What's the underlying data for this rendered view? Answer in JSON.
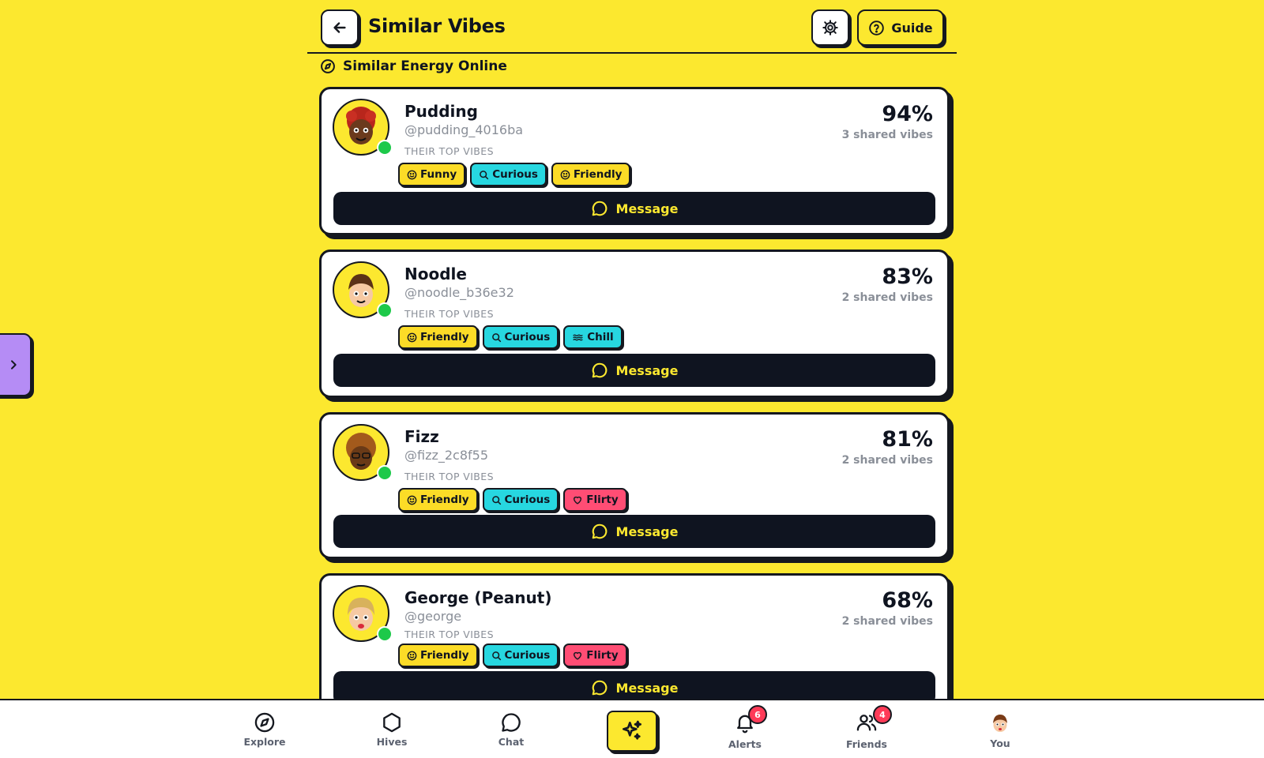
{
  "header": {
    "title": "Similar Vibes",
    "guide_label": "Guide"
  },
  "subheading": "Similar Energy Online",
  "labels": {
    "top_vibes": "THEIR TOP VIBES",
    "message": "Message"
  },
  "colors": {
    "background": "#fce82f",
    "funny_chip": "#fcdc27",
    "curious_chip": "#27d7e0",
    "flirty_chip": "#ff4d74",
    "online": "#1dc94a",
    "side_tab": "#b58cf5"
  },
  "people": [
    {
      "name": "Pudding",
      "handle": "@pudding_4016ba",
      "percent": "94%",
      "shared": "3 shared vibes",
      "chips": [
        {
          "label": "Funny",
          "icon": "smile-icon",
          "style": "funny"
        },
        {
          "label": "Curious",
          "icon": "search-icon",
          "style": "curious"
        },
        {
          "label": "Friendly",
          "icon": "smile-icon",
          "style": "funny"
        }
      ]
    },
    {
      "name": "Noodle",
      "handle": "@noodle_b36e32",
      "percent": "83%",
      "shared": "2 shared vibes",
      "chips": [
        {
          "label": "Friendly",
          "icon": "smile-icon",
          "style": "funny"
        },
        {
          "label": "Curious",
          "icon": "search-icon",
          "style": "curious"
        },
        {
          "label": "Chill",
          "icon": "waves-icon",
          "style": "chill"
        }
      ]
    },
    {
      "name": "Fizz",
      "handle": "@fizz_2c8f55",
      "percent": "81%",
      "shared": "2 shared vibes",
      "chips": [
        {
          "label": "Friendly",
          "icon": "smile-icon",
          "style": "funny"
        },
        {
          "label": "Curious",
          "icon": "search-icon",
          "style": "curious"
        },
        {
          "label": "Flirty",
          "icon": "heart-icon",
          "style": "flirty"
        }
      ]
    },
    {
      "name": "George (Peanut)",
      "handle": "@george",
      "percent": "68%",
      "shared": "2 shared vibes",
      "chips": [
        {
          "label": "Friendly",
          "icon": "smile-icon",
          "style": "funny"
        },
        {
          "label": "Curious",
          "icon": "search-icon",
          "style": "curious"
        },
        {
          "label": "Flirty",
          "icon": "heart-icon",
          "style": "flirty"
        }
      ]
    }
  ],
  "nav": [
    {
      "label": "Explore",
      "icon": "compass-icon"
    },
    {
      "label": "Hives",
      "icon": "hexagon-icon"
    },
    {
      "label": "Chat",
      "icon": "chat-bubble-icon"
    },
    {
      "label": "Alerts",
      "icon": "bell-icon",
      "badge": "6"
    },
    {
      "label": "Friends",
      "icon": "friends-icon",
      "badge": "4"
    },
    {
      "label": "You",
      "icon": "avatar"
    }
  ]
}
